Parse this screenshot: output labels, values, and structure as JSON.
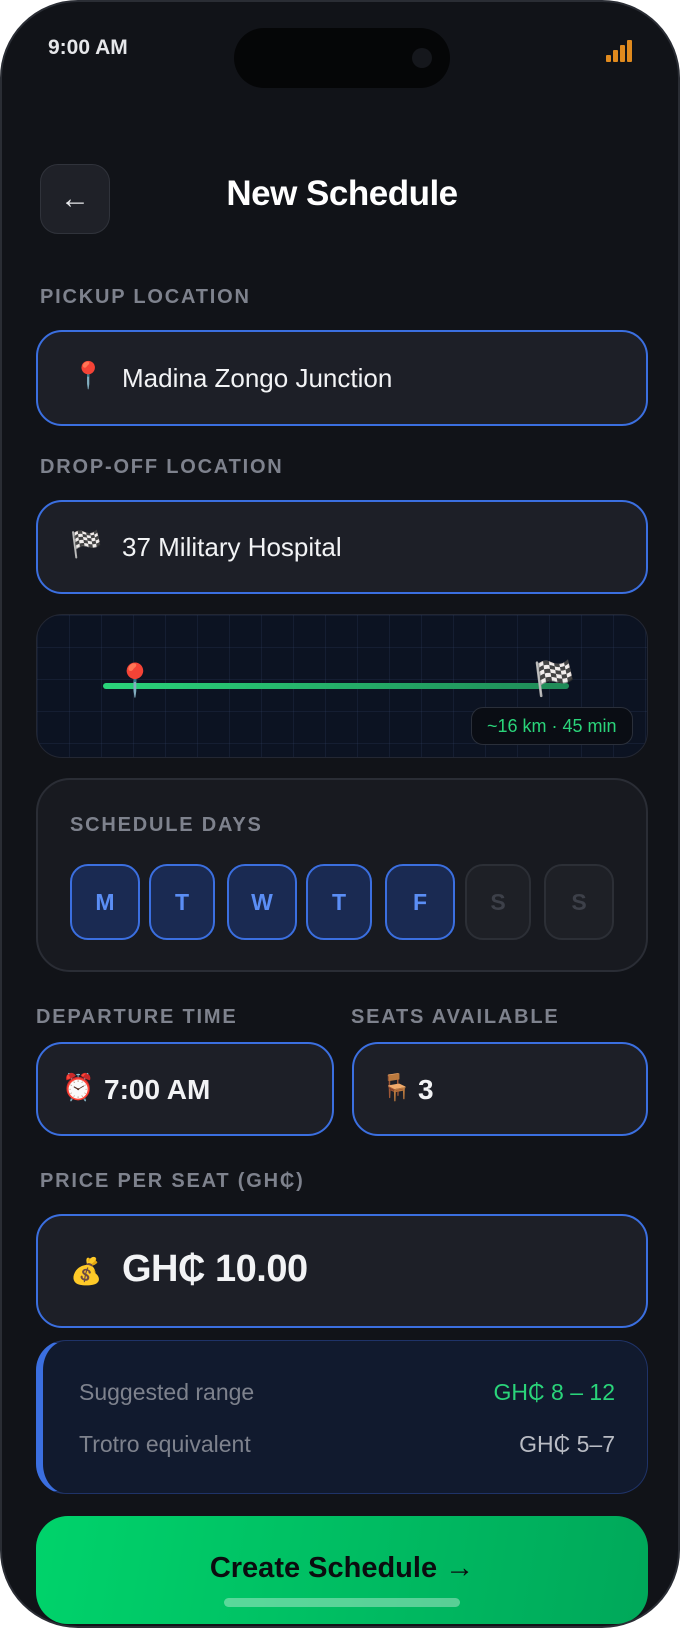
{
  "status_bar": {
    "time": "9:00 AM"
  },
  "header": {
    "back_icon": "←",
    "title": "New Schedule"
  },
  "pickup": {
    "label": "PICKUP LOCATION",
    "icon": "📍",
    "value": "Madina Zongo Junction"
  },
  "dropoff": {
    "label": "DROP-OFF LOCATION",
    "icon": "🏁",
    "value": "37 Military Hospital"
  },
  "route_map": {
    "start_icon": "📍",
    "end_icon": "🏁",
    "summary": "~16 km · 45 min"
  },
  "schedule_days": {
    "label": "SCHEDULE DAYS",
    "days": [
      {
        "letter": "M",
        "selected": true
      },
      {
        "letter": "T",
        "selected": true
      },
      {
        "letter": "W",
        "selected": true
      },
      {
        "letter": "T",
        "selected": true
      },
      {
        "letter": "F",
        "selected": true
      },
      {
        "letter": "S",
        "selected": false
      },
      {
        "letter": "S",
        "selected": false
      }
    ]
  },
  "departure": {
    "label": "DEPARTURE TIME",
    "icon": "⏰",
    "value": "7:00 AM"
  },
  "seats": {
    "label": "SEATS AVAILABLE",
    "icon": "🪑",
    "value": "3"
  },
  "price": {
    "label": "PRICE PER SEAT (GH₵)",
    "icon": "💰",
    "value": "GH₵ 10.00"
  },
  "price_hints": {
    "suggested_label": "Suggested range",
    "suggested_value": "GH₵ 8 – 12",
    "trotro_label": "Trotro equivalent",
    "trotro_value": "GH₵ 5–7"
  },
  "cta": {
    "label": "Create Schedule →"
  },
  "colors": {
    "accent_blue": "#3b6fe0",
    "accent_green": "#00d36b",
    "background": "#111318"
  }
}
